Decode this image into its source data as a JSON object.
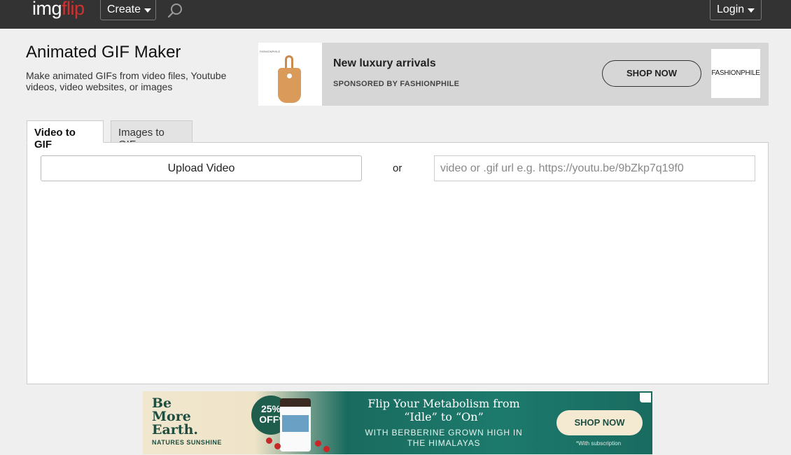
{
  "header": {
    "logo_part1": "img",
    "logo_part2": "flip",
    "create_label": "Create",
    "login_label": "Login",
    "icons": {
      "search": "search-icon",
      "create_dropdown": "chevron-down-icon",
      "login_dropdown": "chevron-down-icon"
    }
  },
  "page": {
    "title": "Animated GIF Maker",
    "description": "Make animated GIFs from video files, Youtube videos, video websites, or images"
  },
  "ad_top": {
    "thumb_caption": "FASHIONPHILE",
    "headline": "New luxury arrivals",
    "sponsor": "SPONSORED BY FASHIONPHILE",
    "cta": "SHOP NOW",
    "brand": "FASHIONPHILE"
  },
  "tabs": [
    {
      "label": "Video to GIF",
      "active": true
    },
    {
      "label": "Images to GIF",
      "active": false
    }
  ],
  "panel": {
    "upload_label": "Upload Video",
    "or_label": "or",
    "url_placeholder": "video or .gif url e.g. https://youtu.be/9bZkp7q19f0",
    "url_value": ""
  },
  "ad_bottom": {
    "brand_line1": "Be",
    "brand_line2": "More",
    "brand_line3": "Earth.",
    "brand_name": "NATURES SUNSHINE",
    "badge_pct": "25%",
    "badge_off": "OFF*",
    "headline_line1": "Flip Your Metabolism from",
    "headline_line2": "“Idle” to “On”",
    "sub_line1": "WITH BERBERINE GROWN HIGH IN",
    "sub_line2": "THE HIMALAYAS",
    "cta": "SHOP NOW",
    "note": "*With subscription"
  },
  "colors": {
    "topbar": "#333333",
    "logo_accent": "#d32f2f",
    "page_bg": "#efefef",
    "ad_green": "#1c7a6c"
  }
}
